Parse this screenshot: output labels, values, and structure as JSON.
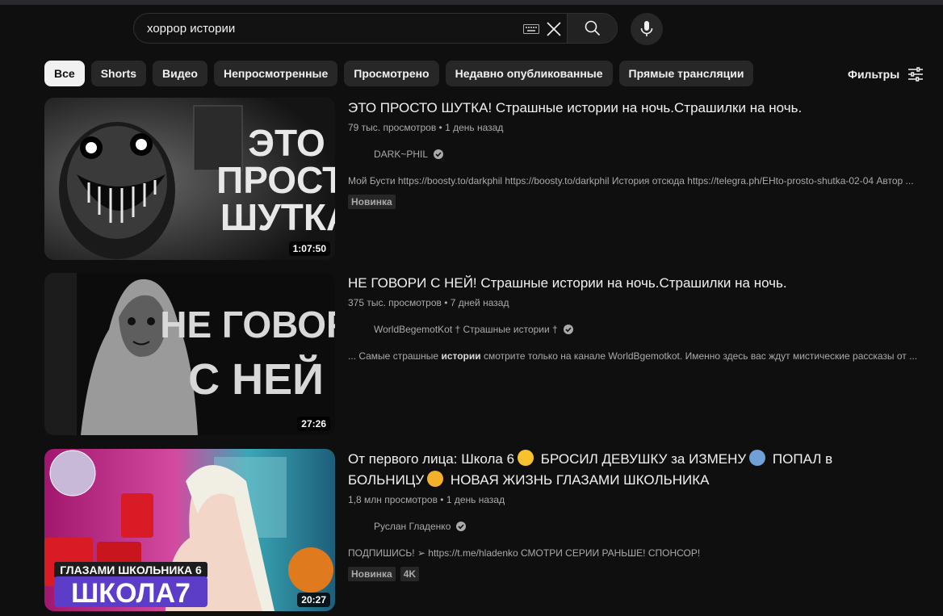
{
  "search": {
    "query": "хоррор истории"
  },
  "chips": [
    "Все",
    "Shorts",
    "Видео",
    "Непросмотренные",
    "Просмотрено",
    "Недавно опубликованные",
    "Прямые трансляции"
  ],
  "filters_label": "Фильтры",
  "results": [
    {
      "title": "ЭТО ПРОСТО ШУТКА! Страшные истории на ночь.Страшилки на ночь.",
      "views": "79 тыс. просмотров",
      "age": "1 день назад",
      "channel": "DARK~PHIL",
      "description": "Мой Бусти https://boosty.to/darkphil https://boosty.to/darkphil История отсюда https://telegra.ph/EHto-prosto-shutka-02-04 Автор ...",
      "badges": [
        "Новинка"
      ],
      "duration": "1:07:50",
      "thumb_lines": [
        "ЭТО",
        "ПРОСТО",
        "ШУТКА"
      ]
    },
    {
      "title": "НЕ ГОВОРИ С НЕЙ! Страшные истории на ночь.Страшилки на ночь.",
      "views": "375 тыс. просмотров",
      "age": "7 дней назад",
      "channel": "WorldBegemotKot † Страшные истории †",
      "description_pre": "... Самые страшные ",
      "description_bold": "истории",
      "description_post": " смотрите только на канале WorldBgemotkot. Именно здесь вас ждут мистические рассказы от ...",
      "badges": [],
      "duration": "27:26",
      "thumb_lines": [
        "НЕ ГОВОРИ",
        "С НЕЙ"
      ]
    },
    {
      "title_part1": "От первого лица: Школа 6",
      "title_part2": "БРОСИЛ ДЕВУШКУ за ИЗМЕНУ",
      "title_part3": "ПОПАЛ в",
      "title_part4": "БОЛЬНИЦУ",
      "title_part5": "НОВАЯ ЖИЗНЬ ГЛАЗАМИ ШКОЛЬНИКА",
      "views": "1,8 млн просмотров",
      "age": "1 день назад",
      "channel": "Руслан Гладенко",
      "description": "ПОДПИШИСЬ! ➢ https://t.me/hladenko СМОТРИ СЕРИИ РАНЬШЕ! СПОНСОР!",
      "badges": [
        "Новинка",
        "4K"
      ],
      "duration": "20:27",
      "thumb_lines": [
        "ГЛАЗАМИ ШКОЛЬНИКА 6",
        "ШКОЛА7"
      ]
    }
  ]
}
